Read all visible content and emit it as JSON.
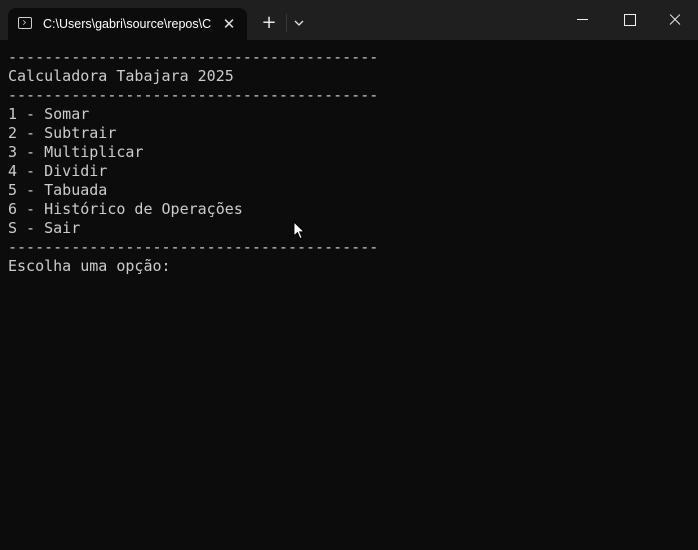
{
  "window": {
    "tab_title": "C:\\Users\\gabri\\source\\repos\\C",
    "tab_icon": "terminal-icon"
  },
  "titlebar": {
    "new_tab_glyph": "+",
    "dropdown_glyph": "⌄",
    "close_tab_glyph": "✕"
  },
  "console": {
    "lines": [
      "-----------------------------------------",
      "Calculadora Tabajara 2025",
      "-----------------------------------------",
      "1 - Somar",
      "2 - Subtrair",
      "3 - Multiplicar",
      "4 - Dividir",
      "5 - Tabuada",
      "6 - Histórico de Operações",
      "S - Sair",
      "-----------------------------------------",
      "Escolha uma opção:"
    ]
  },
  "colors": {
    "background": "#0c0c0c",
    "titlebar": "#1f1f1f",
    "text": "#cccccc"
  }
}
